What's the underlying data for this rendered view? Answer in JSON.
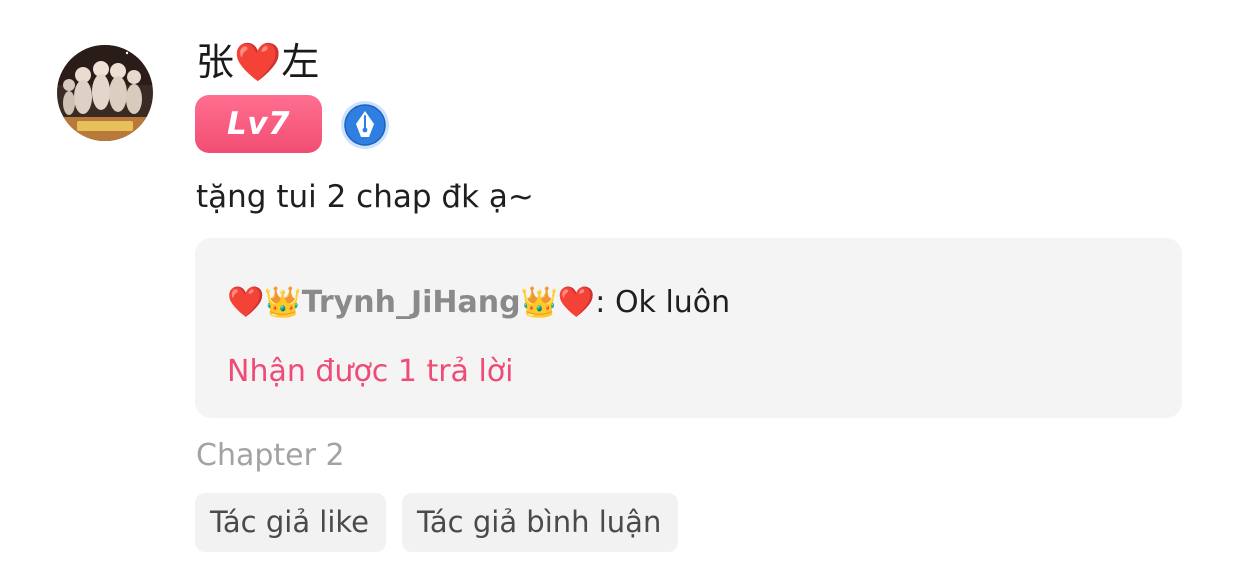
{
  "comment": {
    "user": {
      "name": "张❤️左",
      "level": "Lv7",
      "colors": {
        "level_badge": "#f24d73",
        "pen_badge": "#2f7fe0"
      },
      "icons": {
        "avatar": "user-avatar-photo",
        "badge": "fountain-pen-badge-icon"
      }
    },
    "text": "tặng tui 2 chap đk ạ~",
    "reply_preview": {
      "author": "❤️👑Trynh_JiHang👑❤️",
      "separator": ": ",
      "text": "Ok luôn",
      "count_label": "Nhận được 1 trả lời",
      "count_color": "#ee4c76"
    },
    "chapter": "Chapter 2",
    "tags": [
      {
        "label": "Tác giả like"
      },
      {
        "label": "Tác giả bình luận"
      }
    ]
  }
}
